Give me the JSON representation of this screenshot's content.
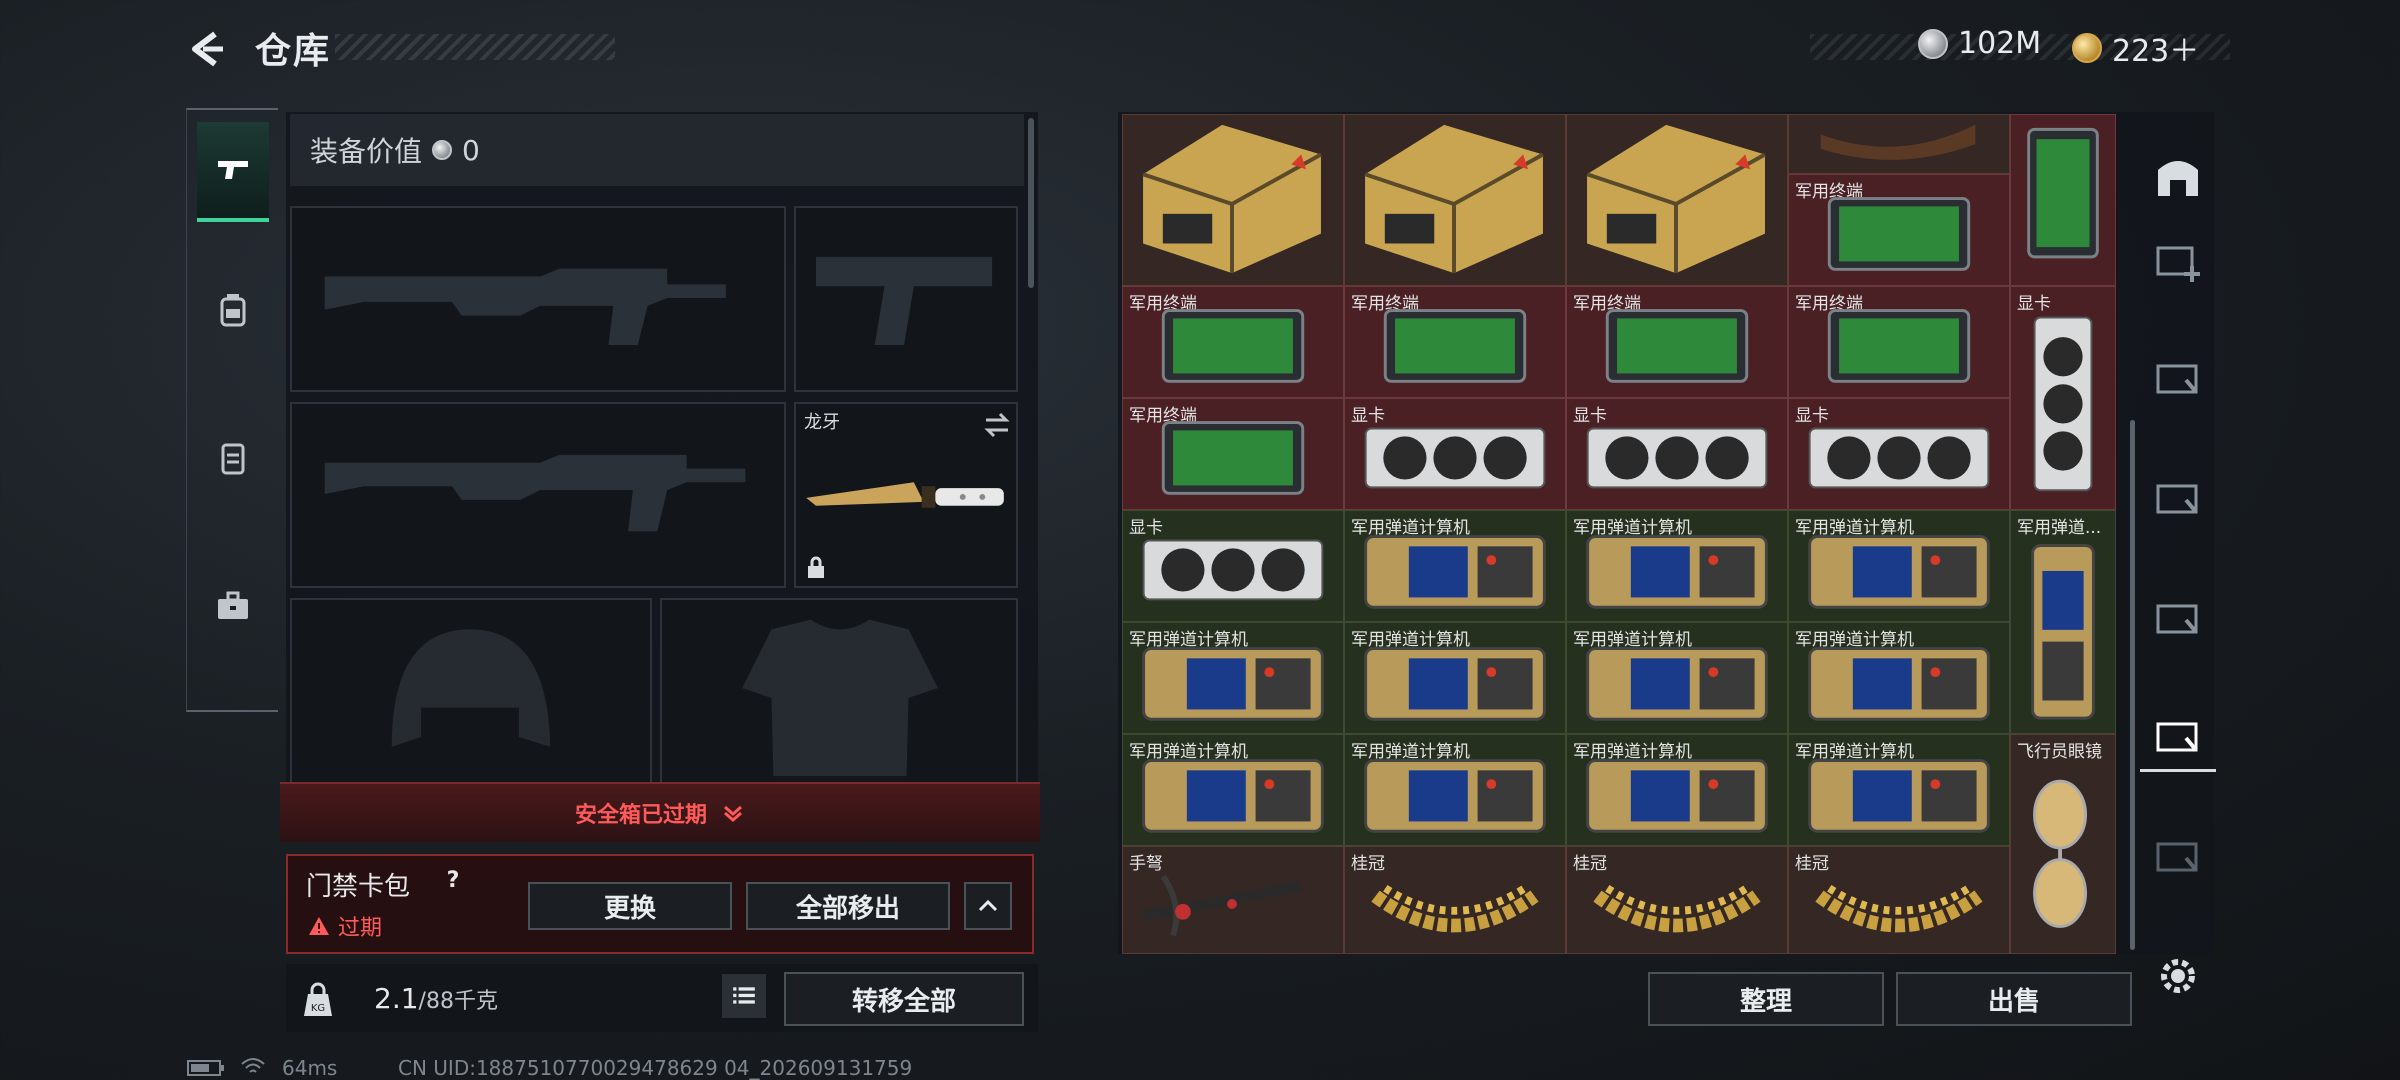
{
  "header": {
    "title": "仓库",
    "currencies": [
      {
        "icon": "silver-coin-icon",
        "value": "102M"
      },
      {
        "icon": "gold-coin-icon",
        "value": "223＋"
      }
    ]
  },
  "left_tabs": [
    {
      "icon": "pistol-icon",
      "active": true
    },
    {
      "icon": "backpack-icon",
      "active": false
    },
    {
      "icon": "vest-icon",
      "active": false
    },
    {
      "icon": "briefcase-icon",
      "active": false
    }
  ],
  "equipment": {
    "value_label": "装备价值",
    "value": "0",
    "knife_label": "龙牙"
  },
  "safe_box": {
    "status_text": "安全箱已过期"
  },
  "card_bag": {
    "title": "门禁卡包",
    "help": "?",
    "expired_text": "过期",
    "replace_label": "更换",
    "move_all_label": "全部移出"
  },
  "weight": {
    "current": "2.1",
    "max": "/88千克",
    "transfer_all_label": "转移全部"
  },
  "inventory": {
    "labels": {
      "terminal": "军用终端",
      "gpu": "显卡",
      "ballistic": "军用弹道计算机",
      "ballistic_short": "军用弹道...",
      "aviator": "飞行员眼镜",
      "crossbow": "手弩",
      "laurel": "桂冠"
    },
    "sort_label": "整理",
    "sell_label": "出售"
  },
  "status": {
    "ping": "64ms",
    "uid": "CN UID:1887510770029478629 04_202609131759"
  },
  "colors": {
    "accent_green": "#3ed39b",
    "danger_red": "#ff5a5a",
    "cell_red": "#4a2024"
  }
}
